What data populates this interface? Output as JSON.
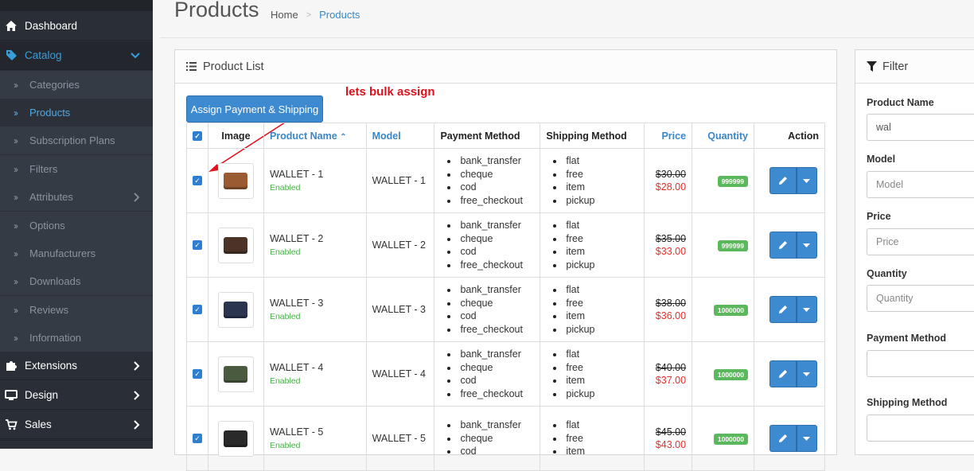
{
  "sidebar": {
    "items": [
      {
        "label": "Dashboard",
        "icon": "home-icon"
      },
      {
        "label": "Catalog",
        "icon": "tag-icon"
      },
      {
        "label": "Extensions",
        "icon": "puzzle-icon"
      },
      {
        "label": "Design",
        "icon": "desktop-icon"
      },
      {
        "label": "Sales",
        "icon": "cart-icon"
      }
    ],
    "catalog_children": [
      "Categories",
      "Products",
      "Subscription Plans",
      "Filters",
      "Attributes",
      "Options",
      "Manufacturers",
      "Downloads",
      "Reviews",
      "Information"
    ]
  },
  "header": {
    "title": "Products",
    "breadcrumb": [
      "Home",
      "Products"
    ]
  },
  "product_list": {
    "panel_title": "Product List",
    "bulk_button": "Assign Payment & Shipping",
    "annotation": "lets bulk assign",
    "columns": [
      "Image",
      "Product Name",
      "Model",
      "Payment Method",
      "Shipping Method",
      "Price",
      "Quantity",
      "Action"
    ],
    "rows": [
      {
        "name": "WALLET - 1",
        "status": "Enabled",
        "model": "WALLET - 1",
        "payment": [
          "bank_transfer",
          "cheque",
          "cod",
          "free_checkout"
        ],
        "shipping": [
          "flat",
          "free",
          "item",
          "pickup"
        ],
        "old_price": "$30.00",
        "new_price": "$28.00",
        "quantity": "999999",
        "color": "#9a5a32"
      },
      {
        "name": "WALLET - 2",
        "status": "Enabled",
        "model": "WALLET - 2",
        "payment": [
          "bank_transfer",
          "cheque",
          "cod",
          "free_checkout"
        ],
        "shipping": [
          "flat",
          "free",
          "item",
          "pickup"
        ],
        "old_price": "$35.00",
        "new_price": "$33.00",
        "quantity": "999999",
        "color": "#4b3427"
      },
      {
        "name": "WALLET - 3",
        "status": "Enabled",
        "model": "WALLET - 3",
        "payment": [
          "bank_transfer",
          "cheque",
          "cod",
          "free_checkout"
        ],
        "shipping": [
          "flat",
          "free",
          "item",
          "pickup"
        ],
        "old_price": "$38.00",
        "new_price": "$36.00",
        "quantity": "1000000",
        "color": "#2b3550"
      },
      {
        "name": "WALLET - 4",
        "status": "Enabled",
        "model": "WALLET - 4",
        "payment": [
          "bank_transfer",
          "cheque",
          "cod",
          "free_checkout"
        ],
        "shipping": [
          "flat",
          "free",
          "item",
          "pickup"
        ],
        "old_price": "$40.00",
        "new_price": "$37.00",
        "quantity": "1000000",
        "color": "#4a5a3e"
      },
      {
        "name": "WALLET - 5",
        "status": "Enabled",
        "model": "WALLET - 5",
        "payment": [
          "bank_transfer",
          "cheque",
          "cod"
        ],
        "shipping": [
          "flat",
          "free",
          "item"
        ],
        "old_price": "$45.00",
        "new_price": "$43.00",
        "quantity": "1000000",
        "color": "#2a2a2a"
      }
    ]
  },
  "filter": {
    "title": "Filter",
    "fields": [
      {
        "label": "Product Name",
        "value": "wal",
        "placeholder": ""
      },
      {
        "label": "Model",
        "value": "",
        "placeholder": "Model"
      },
      {
        "label": "Price",
        "value": "",
        "placeholder": "Price"
      },
      {
        "label": "Quantity",
        "value": "",
        "placeholder": "Quantity"
      },
      {
        "label": "Payment Method",
        "value": "",
        "placeholder": ""
      },
      {
        "label": "Shipping Method",
        "value": "",
        "placeholder": ""
      }
    ]
  },
  "colors": {
    "accent": "#3d8ad1",
    "sidebar": "#2a2f37",
    "annotation": "#e0101d",
    "success": "#5cb85c",
    "sale": "#e0302b"
  }
}
